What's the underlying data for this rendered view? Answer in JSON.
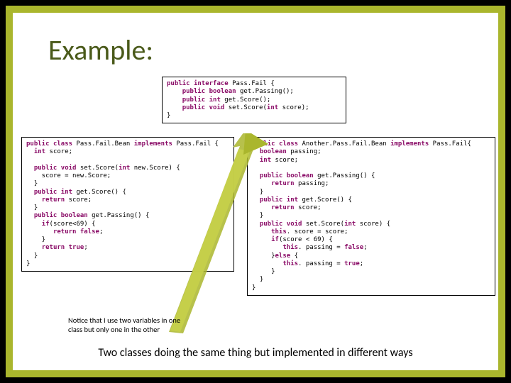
{
  "title": "Example:",
  "code_top": "public interface Pass.Fail {\n    public boolean get.Passing();\n    public int get.Score();\n    public void set.Score(int score);\n}",
  "code_left": "public class Pass.Fail.Bean implements Pass.Fail {\n  int score;\n\n  public void set.Score(int new.Score) {\n    score = new.Score;\n  }\n  public int get.Score() {\n    return score;\n  }\n  public boolean get.Passing() {\n    if(score<69) {\n       return false;\n    }\n    return true;\n  }\n}",
  "code_right": "public class Another.Pass.Fail.Bean implements Pass.Fail{\n  boolean passing;\n  int score;\n\n  public boolean get.Passing() {\n     return passing;\n  }\n  public int get.Score() {\n     return score;\n  }\n  public void set.Score(int score) {\n     this. score = score;\n     if(score < 69) {\n        this. passing = false;\n     }else {\n        this. passing = true;\n     }\n  }\n}",
  "note": "Notice that I use two variables in one class but only one in the other",
  "bottom_caption": "Two classes doing the same thing but implemented in different ways",
  "keywords": [
    "public",
    "interface",
    "boolean",
    "int",
    "void",
    "class",
    "implements",
    "return",
    "if",
    "else",
    "this",
    "true",
    "false"
  ]
}
